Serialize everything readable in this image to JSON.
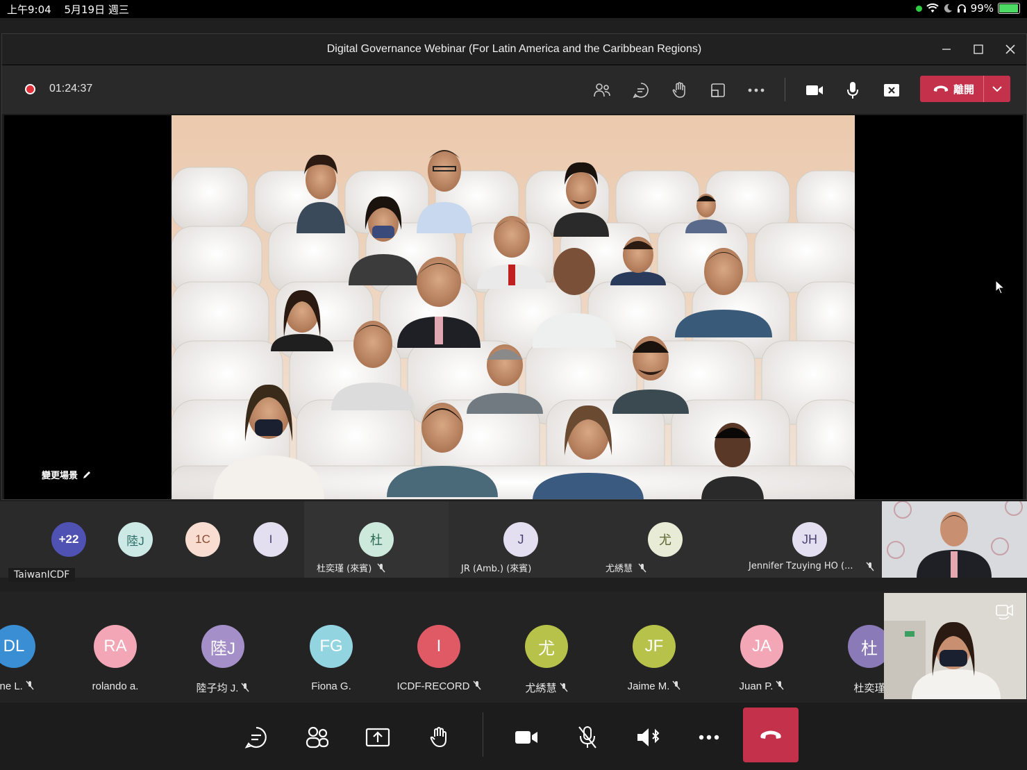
{
  "status_bar": {
    "time": "上午9:04",
    "date": "5月19日 週三",
    "battery": "99%"
  },
  "window": {
    "title": "Digital Governance Webinar (For Latin America and the Caribbean Regions)"
  },
  "toolbar": {
    "timer": "01:24:37",
    "leave_label": "離開"
  },
  "stage": {
    "change_scene_label": "變更場景"
  },
  "strip1": {
    "overflow_count": "+22",
    "org_label": "TaiwanICDF",
    "small_avatars": [
      {
        "initials": "陸J",
        "bg": "#cde9e6",
        "fg": "#2b6b66"
      },
      {
        "initials": "1C",
        "bg": "#f8ddd0",
        "fg": "#8b4a30"
      },
      {
        "initials": "I",
        "bg": "#e4dff0",
        "fg": "#4a4070"
      }
    ],
    "tiles": [
      {
        "initials": "杜",
        "name": "杜奕瑾 (來賓)",
        "bg": "#cde9dc",
        "fg": "#2b6b55"
      },
      {
        "initials": "J",
        "name": "JR (Amb.) (來賓)",
        "bg": "#e4dff0",
        "fg": "#4a4070"
      },
      {
        "initials": "尤",
        "name": "尤綉慧",
        "bg": "#e8ecd6",
        "fg": "#5a6330"
      },
      {
        "initials": "JH",
        "name": "Jennifer Tzuying HO (...",
        "bg": "#e4dff0",
        "fg": "#4a4070"
      }
    ]
  },
  "participants": [
    {
      "initials": "DL",
      "name": "nne L.",
      "color": "#3a8fd4"
    },
    {
      "initials": "RA",
      "name": "rolando a.",
      "color": "#f2a6b6"
    },
    {
      "initials": "陸J",
      "name": "陸子均 J.",
      "color": "#a48fc9"
    },
    {
      "initials": "FG",
      "name": "Fiona G.",
      "color": "#92d4e0"
    },
    {
      "initials": "I",
      "name": "ICDF-RECORD",
      "color": "#e05a66"
    },
    {
      "initials": "尤",
      "name": "尤綉慧",
      "color": "#b7c24a"
    },
    {
      "initials": "JF",
      "name": "Jaime M.",
      "color": "#b7c24a"
    },
    {
      "initials": "JA",
      "name": "Juan P.",
      "color": "#f2a6b6"
    },
    {
      "initials": "杜",
      "name": "杜奕瑾",
      "color": "#8a7ab8"
    }
  ]
}
